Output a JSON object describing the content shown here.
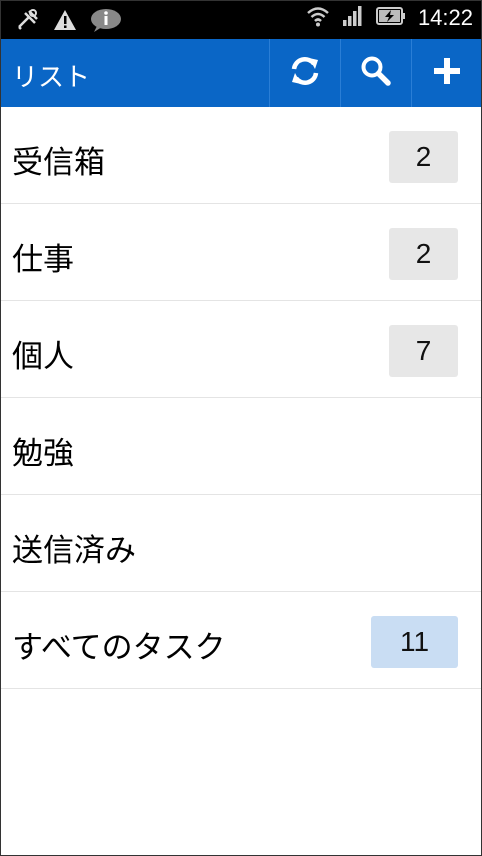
{
  "status_bar": {
    "time": "14:22",
    "left_icons": [
      "usb-debug-icon",
      "warning-icon",
      "info-bubble-icon"
    ],
    "right_icons": [
      "wifi-icon",
      "signal-icon",
      "battery-charging-icon"
    ]
  },
  "action_bar": {
    "title": "リスト",
    "buttons": [
      "sync-icon",
      "search-icon",
      "add-icon"
    ]
  },
  "lists": [
    {
      "label": "受信箱",
      "count": "2"
    },
    {
      "label": "仕事",
      "count": "2"
    },
    {
      "label": "個人",
      "count": "7"
    },
    {
      "label": "勉強",
      "count": ""
    },
    {
      "label": "送信済み",
      "count": ""
    },
    {
      "label": "すべてのタスク",
      "count": "11"
    }
  ],
  "colors": {
    "action_bar": "#0a66c6",
    "badge": "#e7e7e7",
    "badge_all": "#c9ddf3"
  }
}
